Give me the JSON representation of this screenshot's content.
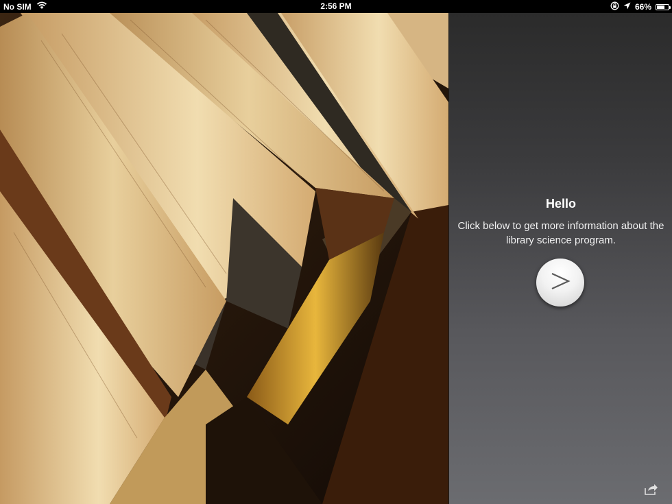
{
  "status_bar": {
    "carrier": "No SIM",
    "time": "2:56 PM",
    "battery_percent": "66%",
    "battery_level": 0.66,
    "icons": [
      "wifi-icon",
      "rotation-lock-icon",
      "location-arrow-icon",
      "battery-icon"
    ]
  },
  "photo": {
    "icon": "books-photo"
  },
  "panel": {
    "title": "Hello",
    "description": "Click below to get more information about the library science program.",
    "next_icon": "chevron-right-icon",
    "share_icon": "share-icon"
  },
  "colors": {
    "panel_top": "#2b2b2b",
    "panel_bottom": "#6b6c70",
    "status_bar": "#000000"
  }
}
